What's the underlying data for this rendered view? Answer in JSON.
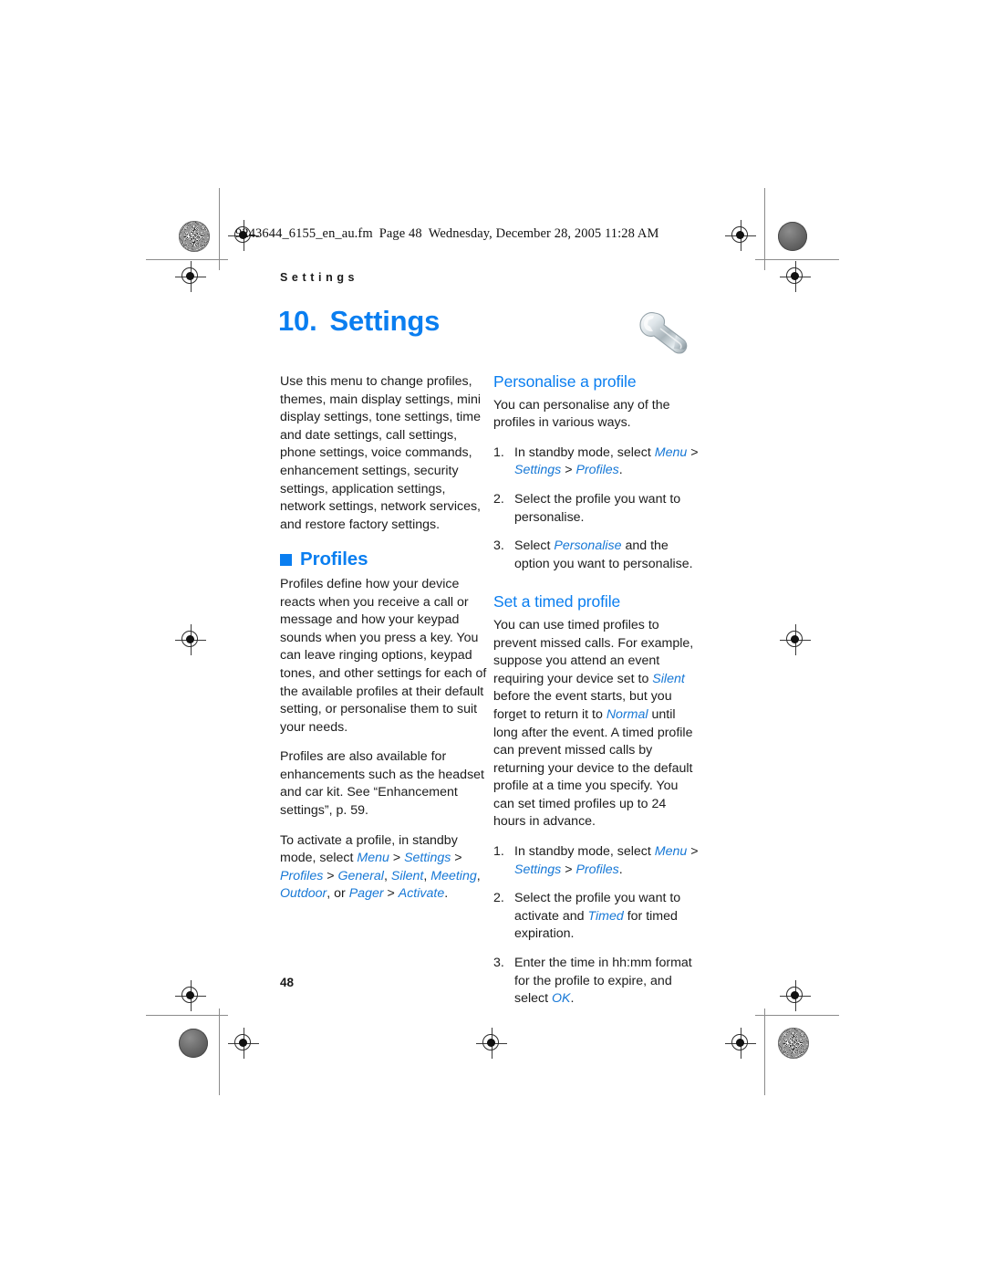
{
  "fm_header": {
    "filename": "9243644_6155_en_au.fm",
    "page_label": "Page 48",
    "timestamp": "Wednesday, December 28, 2005  11:28 AM"
  },
  "running_head": "S e t t i n g s",
  "chapter": {
    "number": "10.",
    "title": "Settings",
    "icon": "wrench-icon"
  },
  "colors": {
    "accent_blue": "#0a7ef0",
    "link_blue": "#1778d6",
    "body_text": "#1c1c1c"
  },
  "left_column": {
    "intro": "Use this menu to change profiles, themes, main display settings, mini display settings, tone settings, time and date settings, call settings, phone settings, voice commands, enhancement settings, security settings, application settings, network settings, network services, and restore factory settings.",
    "section_heading": "Profiles",
    "paragraph_1": "Profiles define how your device reacts when you receive a call or message and how your keypad sounds when you press a key. You can leave ringing options, keypad tones, and other settings for each of the available profiles at their default setting, or personalise them to suit your needs.",
    "paragraph_2": "Profiles are also available for enhancements such as the headset and car kit. See “Enhancement settings”, p. 59.",
    "activate_lead": "To activate a profile, in standby mode, select ",
    "activate_path": [
      "Menu",
      "Settings",
      "Profiles"
    ],
    "activate_profiles": [
      "General",
      "Silent",
      "Meeting",
      "Outdoor"
    ],
    "activate_or": ", or ",
    "activate_tail_path": [
      "Pager",
      "Activate"
    ],
    "activate_comma": ", ",
    "separator": " > ",
    "period": "."
  },
  "right_column": {
    "personalise": {
      "heading": "Personalise a profile",
      "intro": "You can personalise any of the profiles in various ways.",
      "steps": [
        {
          "n": "1.",
          "parts": [
            {
              "t": "In standby mode, select ",
              "s": "plain"
            },
            {
              "t": "Menu",
              "s": "ui"
            },
            {
              "t": " > ",
              "s": "plain"
            },
            {
              "t": "Settings",
              "s": "ui"
            },
            {
              "t": " > ",
              "s": "plain"
            },
            {
              "t": "Profiles",
              "s": "ui"
            },
            {
              "t": ".",
              "s": "plain"
            }
          ]
        },
        {
          "n": "2.",
          "parts": [
            {
              "t": "Select the profile you want to personalise.",
              "s": "plain"
            }
          ]
        },
        {
          "n": "3.",
          "parts": [
            {
              "t": "Select ",
              "s": "plain"
            },
            {
              "t": "Personalise",
              "s": "ui"
            },
            {
              "t": " and the option you want to personalise.",
              "s": "plain"
            }
          ]
        }
      ]
    },
    "timed": {
      "heading": "Set a timed profile",
      "intro_parts": [
        {
          "t": "You can use timed profiles to prevent missed calls. For example, suppose you attend an event requiring your device set to ",
          "s": "plain"
        },
        {
          "t": "Silent",
          "s": "ui"
        },
        {
          "t": " before the event starts, but you forget to return it to ",
          "s": "plain"
        },
        {
          "t": "Normal",
          "s": "ui"
        },
        {
          "t": " until long after the event. A timed profile can prevent missed calls by returning your device to the default profile at a time you specify. You can set timed profiles up to 24 hours in advance.",
          "s": "plain"
        }
      ],
      "steps": [
        {
          "n": "1.",
          "parts": [
            {
              "t": "In standby mode, select ",
              "s": "plain"
            },
            {
              "t": "Menu",
              "s": "ui"
            },
            {
              "t": " > ",
              "s": "plain"
            },
            {
              "t": "Settings",
              "s": "ui"
            },
            {
              "t": " > ",
              "s": "plain"
            },
            {
              "t": "Profiles",
              "s": "ui"
            },
            {
              "t": ".",
              "s": "plain"
            }
          ]
        },
        {
          "n": "2.",
          "parts": [
            {
              "t": "Select the profile you want to activate and ",
              "s": "plain"
            },
            {
              "t": "Timed",
              "s": "ui"
            },
            {
              "t": " for timed expiration.",
              "s": "plain"
            }
          ]
        },
        {
          "n": "3.",
          "parts": [
            {
              "t": "Enter the time in hh:mm format for the profile to expire, and select ",
              "s": "plain"
            },
            {
              "t": "OK",
              "s": "ui"
            },
            {
              "t": ".",
              "s": "plain"
            }
          ]
        }
      ]
    }
  },
  "page_number": "48"
}
